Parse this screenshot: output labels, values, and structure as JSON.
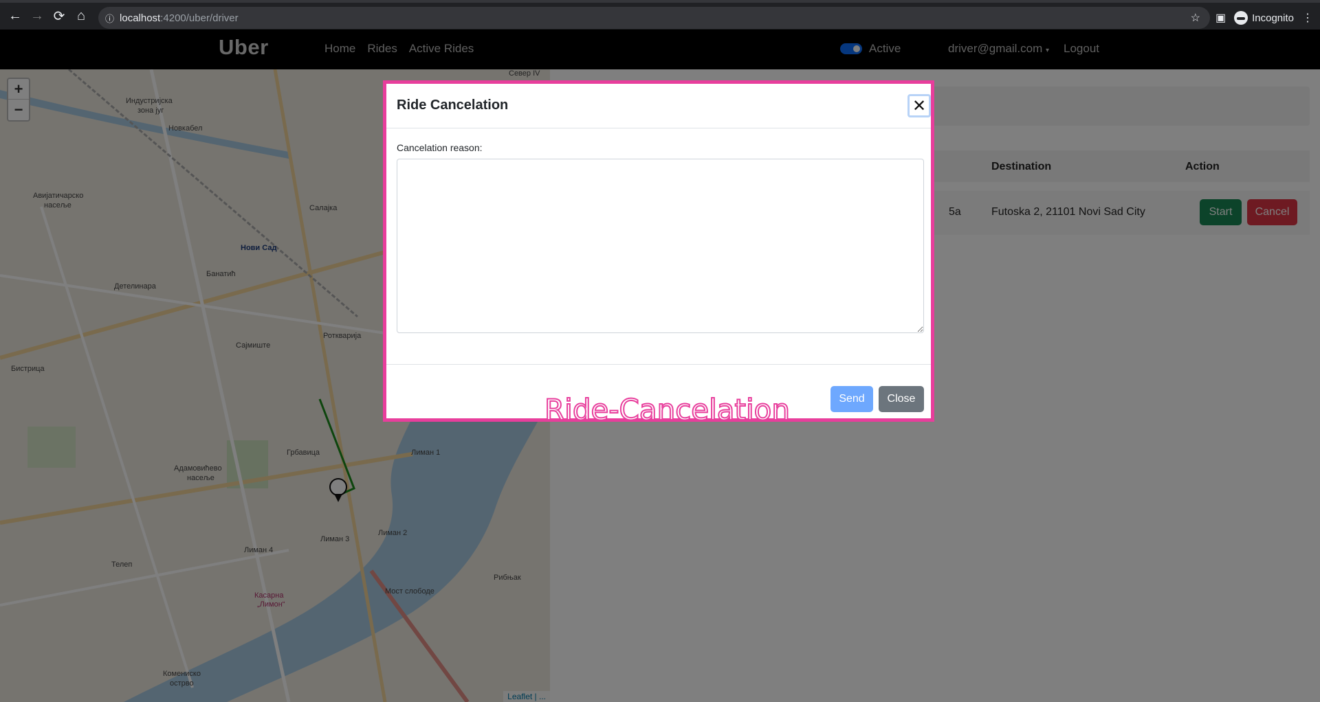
{
  "browser": {
    "url_host": "localhost",
    "url_path": ":4200/uber/driver",
    "incognito_label": "Incognito"
  },
  "navbar": {
    "brand": "Uber",
    "links": [
      "Home",
      "Rides",
      "Active Rides"
    ],
    "toggle_label": "Active",
    "toggle_on": true,
    "user_email": "driver@gmail.com",
    "logout": "Logout"
  },
  "map": {
    "zoom_in": "+",
    "zoom_out": "−",
    "attribution": "Leaflet | ...",
    "labels": [
      "Индустријска зона југ",
      "Новкабел",
      "Авијатичарско насеље",
      "Нови Сад",
      "Банатић",
      "Детелинара",
      "Салајка",
      "Сајмиште",
      "Ротквариjа",
      "Бистрица",
      "Грбавица",
      "Адамовићево насеље",
      "Лиман 1",
      "Лиман 2",
      "Лиман 3",
      "Лиман 4",
      "Телеп",
      "Мост слободе",
      "Рибњак",
      "Комениско острво",
      "Север IV",
      "Касарна Лимон"
    ]
  },
  "rides_table": {
    "headers": {
      "destination": "Destination",
      "action": "Action"
    },
    "rows": [
      {
        "start_partial": "5a",
        "destination": "Futoska 2, 21101 Novi Sad City",
        "start_btn": "Start",
        "cancel_btn": "Cancel"
      }
    ]
  },
  "modal": {
    "title": "Ride Cancelation",
    "close_icon": "close-icon",
    "field_label": "Cancelation reason:",
    "reason_value": "",
    "send_label": "Send",
    "close_label": "Close",
    "overlay_caption": "Ride-Cancelation"
  },
  "colors": {
    "highlight": "#e83e9c",
    "primary": "#0d6efd",
    "success": "#198754",
    "danger": "#dc3545",
    "secondary": "#6c757d"
  }
}
